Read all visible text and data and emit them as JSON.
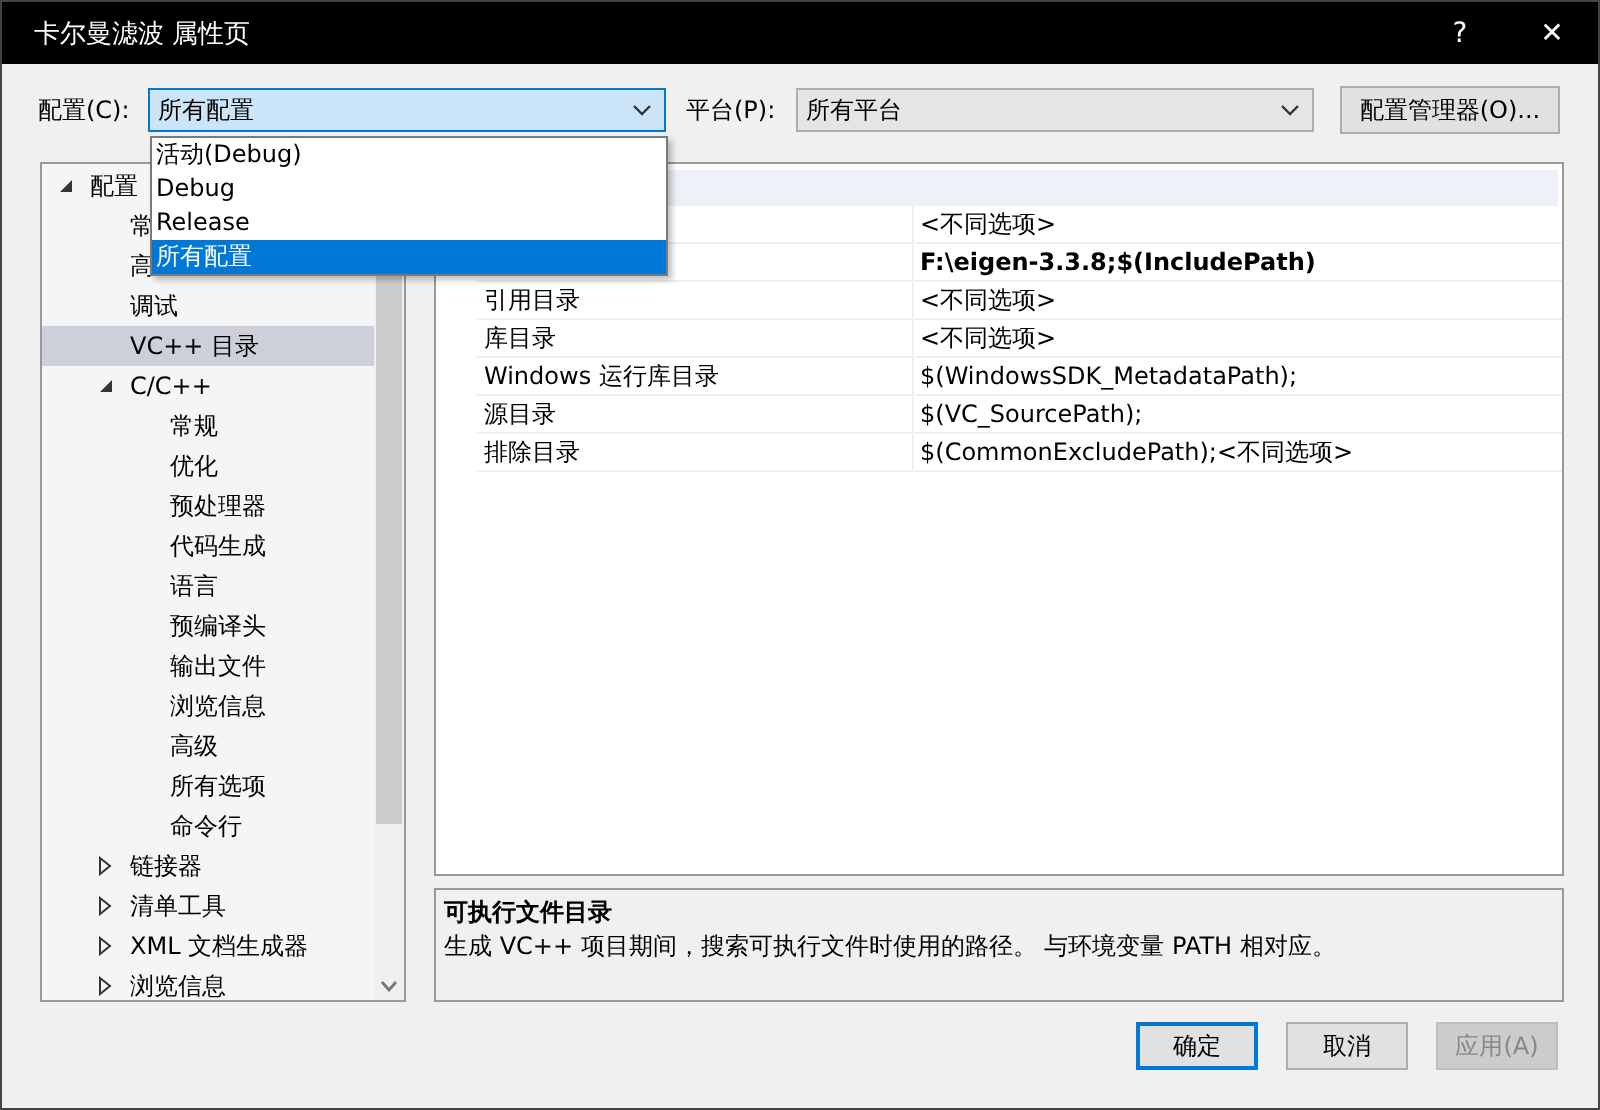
{
  "window": {
    "title": "卡尔曼滤波 属性页",
    "help": "?",
    "close": "✕"
  },
  "config": {
    "label": "配置(C):",
    "value": "所有配置",
    "open": true,
    "options": [
      {
        "label": "活动(Debug)",
        "selected": false
      },
      {
        "label": "Debug",
        "selected": false
      },
      {
        "label": "Release",
        "selected": false
      },
      {
        "label": "所有配置",
        "selected": true
      }
    ]
  },
  "platform": {
    "label": "平台(P):",
    "value": "所有平台"
  },
  "config_manager_button": "配置管理器(O)...",
  "tree": [
    {
      "label": "配置",
      "expanded": true,
      "selected": false,
      "children": [
        {
          "label": "常",
          "selected": false
        },
        {
          "label": "高",
          "selected": false
        },
        {
          "label": "调试",
          "selected": false
        },
        {
          "label": "VC++ 目录",
          "selected": true
        },
        {
          "label": "C/C++",
          "expanded": true,
          "selected": false,
          "children": [
            {
              "label": "常规",
              "selected": false
            },
            {
              "label": "优化",
              "selected": false
            },
            {
              "label": "预处理器",
              "selected": false
            },
            {
              "label": "代码生成",
              "selected": false
            },
            {
              "label": "语言",
              "selected": false
            },
            {
              "label": "预编译头",
              "selected": false
            },
            {
              "label": "输出文件",
              "selected": false
            },
            {
              "label": "浏览信息",
              "selected": false
            },
            {
              "label": "高级",
              "selected": false
            },
            {
              "label": "所有选项",
              "selected": false
            },
            {
              "label": "命令行",
              "selected": false
            }
          ]
        },
        {
          "label": "链接器",
          "expanded": false,
          "selected": false
        },
        {
          "label": "清单工具",
          "expanded": false,
          "selected": false
        },
        {
          "label": "XML 文档生成器",
          "expanded": false,
          "selected": false
        },
        {
          "label": "浏览信息",
          "expanded": false,
          "selected": false
        }
      ]
    }
  ],
  "grid": {
    "rows": [
      {
        "value": "<不同选项>",
        "bold": false
      },
      {
        "value": "F:\\eigen-3.3.8;$(IncludePath)",
        "bold": true
      },
      {
        "label": "引用目录",
        "value": "<不同选项>",
        "bold": false
      },
      {
        "label": "库目录",
        "value": "<不同选项>",
        "bold": false
      },
      {
        "label": "Windows 运行库目录",
        "value": "$(WindowsSDK_MetadataPath);",
        "bold": false
      },
      {
        "label": "源目录",
        "value": "$(VC_SourcePath);",
        "bold": false
      },
      {
        "label": "排除目录",
        "value": "$(CommonExcludePath);<不同选项>",
        "bold": false
      }
    ]
  },
  "help": {
    "title": "可执行文件目录",
    "text": "生成 VC++ 项目期间，搜索可执行文件时使用的路径。  与环境变量 PATH 相对应。"
  },
  "buttons": [
    {
      "label": "确定",
      "default": true,
      "disabled": false
    },
    {
      "label": "取消",
      "default": false,
      "disabled": false
    },
    {
      "label": "应用(A)",
      "default": false,
      "disabled": true
    }
  ]
}
